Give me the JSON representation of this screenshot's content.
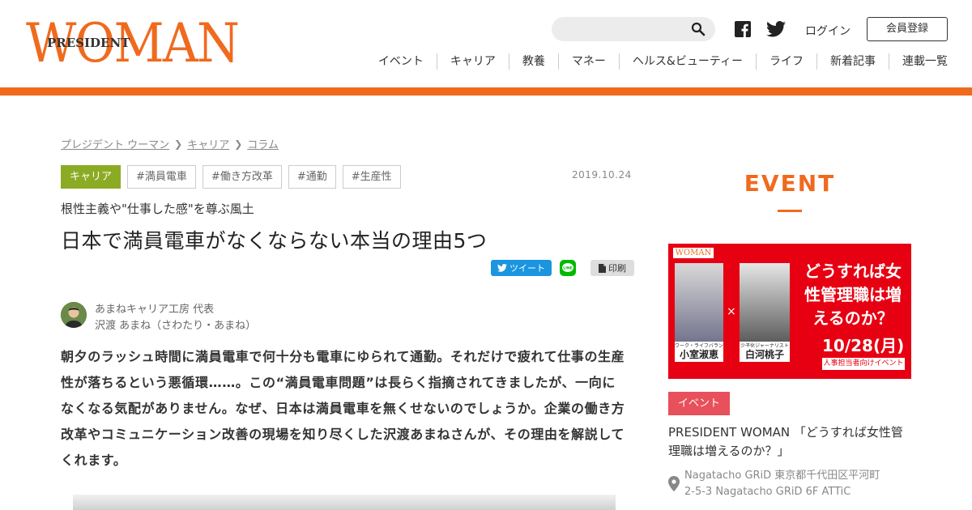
{
  "header": {
    "logo_brand": "WOMAN",
    "logo_sub": "PRESIDENT",
    "login_label": "ログイン",
    "register_label": "会員登録",
    "icons": [
      "search-icon",
      "facebook-icon",
      "twitter-icon"
    ],
    "nav": [
      "イベント",
      "キャリア",
      "教養",
      "マネー",
      "ヘルス&ビューティー",
      "ライフ",
      "新着記事",
      "連載一覧"
    ],
    "accent_color": "#f06a1e"
  },
  "breadcrumb": [
    "プレジデント ウーマン",
    "キャリア",
    "コラム"
  ],
  "article": {
    "category": "キャリア",
    "tags": [
      "#満員電車",
      "#働き方改革",
      "#通勤",
      "#生産性"
    ],
    "date": "2019.10.24",
    "subtitle": "根性主義や\"仕事した感\"を尊ぶ風土",
    "title": "日本で満員電車がなくならない本当の理由5つ",
    "share": {
      "tweet_label": "ツイート",
      "line_label": "LINE",
      "print_label": "印刷"
    },
    "author": {
      "affiliation": "あまねキャリア工房 代表",
      "name": "沢渡 あまね（さわたり・あまね）"
    },
    "lead": "朝夕のラッシュ時間に満員電車で何十分も電車にゆられて通勤。それだけで疲れて仕事の生産性が落ちるという悪循環……。この“満員電車問題”は長らく指摘されてきましたが、一向になくなる気配がありません。なぜ、日本は満員電車を無くせないのでしょうか。企業の働き方改革やコミュニケーション改善の現場を知り尽くした沢渡あまねさんが、その理由を解説してくれます。"
  },
  "sidebar": {
    "heading": "EVENT",
    "banner": {
      "logo": "WOMAN",
      "person1_role": "ワーク・ライフバランス代表",
      "person1_name": "小室淑恵",
      "person2_role": "少子化ジャーナリスト",
      "person2_name": "白河桃子",
      "cross": "×",
      "headline": "どうすれば女性管理職は増えるのか？",
      "date": "10/28(月)",
      "target": "人事担当者向けイベント"
    },
    "badge": "イベント",
    "event_title": "PRESIDENT WOMAN 「どうすれば女性管理職は増えるのか？」",
    "venue": "Nagatacho GRiD 東京都千代田区平河町2-5-3 Nagatacho GRiD 6F ATTiC",
    "venue_line1": "Nagatacho GRiD 東京都千代田区平河町",
    "venue_line2": "2-5-3 Nagatacho GRiD 6F ATTiC"
  }
}
